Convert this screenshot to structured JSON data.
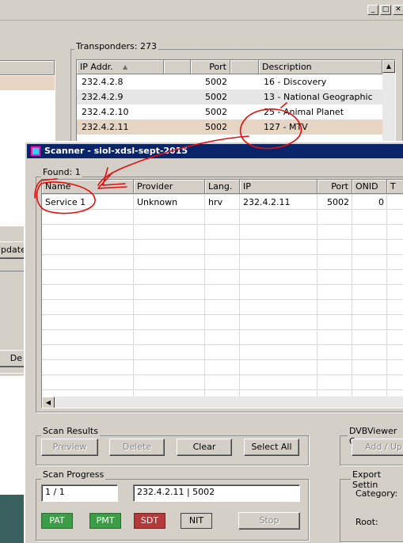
{
  "main": {
    "transponders_label": "Transponders: 273",
    "left_button_update": "Update",
    "left_button_de": "De",
    "transponders_table": {
      "columns": [
        "IP Addr.",
        "Port",
        "Description"
      ],
      "rows": [
        {
          "ip": "232.4.2.8",
          "port": "5002",
          "desc": "16 - Discovery"
        },
        {
          "ip": "232.4.2.9",
          "port": "5002",
          "desc": "13 - National Geographic"
        },
        {
          "ip": "232.4.2.10",
          "port": "5002",
          "desc": "25 - Animal Planet"
        },
        {
          "ip": "232.4.2.11",
          "port": "5002",
          "desc": "127 - MTV"
        }
      ]
    }
  },
  "scanner": {
    "title": "Scanner - siol-xdsl-sept-2015",
    "found_label": "Found: 1",
    "columns": [
      "Name",
      "Provider",
      "Lang.",
      "IP",
      "Port",
      "ONID",
      "T"
    ],
    "rows": [
      {
        "name": "Service 1",
        "provider": "Unknown",
        "lang": "hrv",
        "ip": "232.4.2.11",
        "port": "5002",
        "onid": "0"
      }
    ],
    "scan_results": {
      "label": "Scan Results",
      "preview": "Preview",
      "delete": "Delete",
      "clear": "Clear",
      "select_all": "Select All"
    },
    "dvbviewer": {
      "label": "DVBViewer C",
      "add_update": "Add / Up"
    },
    "scan_progress": {
      "label": "Scan Progress",
      "count": "1 / 1",
      "current": "232.4.2.11 | 5002",
      "pat": "PAT",
      "pmt": "PMT",
      "sdt": "SDT",
      "nit": "NIT",
      "stop": "Stop"
    },
    "export": {
      "label": "Export Settin",
      "category": "Category:",
      "root": "Root:"
    }
  },
  "colors": {
    "selected_row": "#e6d5c3",
    "alt_row": "#e6e6e6",
    "title_bar": "#0a246a",
    "pat_pmt": "#3c9c48",
    "sdt": "#b23a3a",
    "annotation": "#e01010"
  }
}
